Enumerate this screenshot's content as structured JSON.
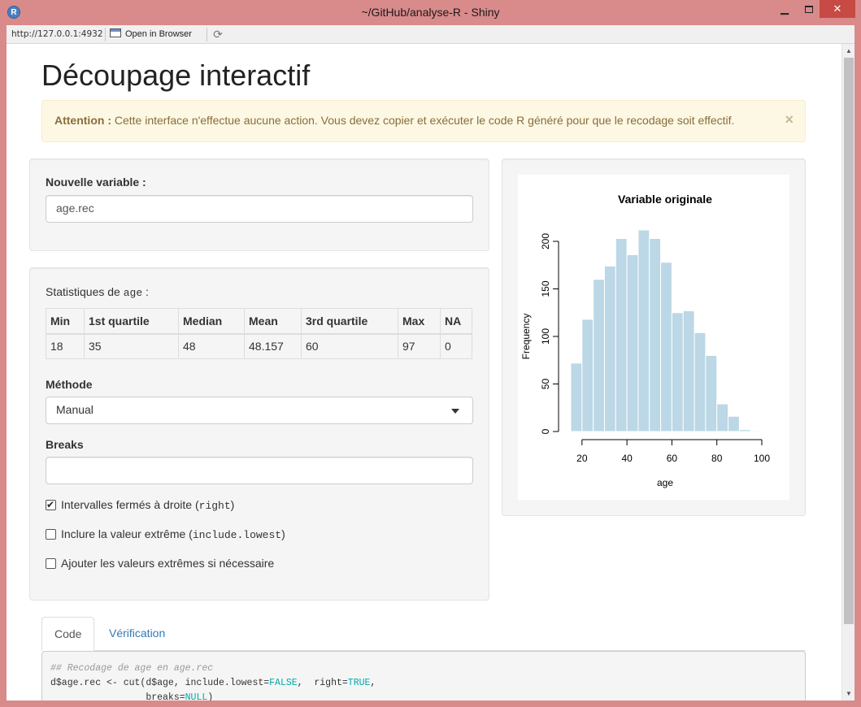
{
  "window": {
    "title": "~/GitHub/analyse-R - Shiny",
    "minimize": "—",
    "maximize": "",
    "close": "✕"
  },
  "toolbar": {
    "url": "http://127.0.0.1:4932",
    "open_in_browser": "Open in Browser"
  },
  "page": {
    "title": "Découpage interactif",
    "alert": {
      "strong": "Attention :",
      "text": "Cette interface n'effectue aucune action. Vous devez copier et exécuter le code R généré pour que le recodage soit effectif.",
      "close": "×"
    }
  },
  "new_variable": {
    "label": "Nouvelle variable :",
    "value": "age.rec"
  },
  "stats": {
    "caption_prefix": "Statistiques de",
    "variable": "age",
    "caption_suffix": ":",
    "headers": [
      "Min",
      "1st quartile",
      "Median",
      "Mean",
      "3rd quartile",
      "Max",
      "NA"
    ],
    "values": [
      "18",
      "35",
      "48",
      "48.157",
      "60",
      "97",
      "0"
    ]
  },
  "method": {
    "label": "Méthode",
    "selected": "Manual"
  },
  "breaks": {
    "label": "Breaks",
    "value": ""
  },
  "options": [
    {
      "text": "Intervalles fermés à droite",
      "code": "right",
      "checked": true
    },
    {
      "text": "Inclure la valeur extrême",
      "code": "include.lowest",
      "checked": false
    },
    {
      "text": "Ajouter les valeurs extrêmes si nécessaire",
      "code": "",
      "checked": false
    }
  ],
  "chart_data": {
    "type": "bar",
    "title": "Variable originale",
    "xlabel": "age",
    "ylabel": "Frequency",
    "bin_edges": [
      15,
      20,
      25,
      30,
      35,
      40,
      45,
      50,
      55,
      60,
      65,
      70,
      75,
      80,
      85,
      90,
      95,
      100
    ],
    "values": [
      72,
      118,
      160,
      174,
      203,
      186,
      212,
      203,
      178,
      125,
      127,
      104,
      80,
      29,
      16,
      2,
      1
    ],
    "xlim": [
      15,
      100
    ],
    "ylim": [
      0,
      200
    ],
    "xticks": [
      20,
      40,
      60,
      80,
      100
    ],
    "yticks": [
      0,
      50,
      100,
      150,
      200
    ],
    "bar_color": "#bcd7e6",
    "grid": false
  },
  "tabs": {
    "code": "Code",
    "verification": "Vérification"
  },
  "code": {
    "comment": "## Recodage de age en age.rec",
    "line1_a": "d$age.rec <- cut(d$age, include.lowest=",
    "line1_false": "FALSE",
    "line1_b": ",  right=",
    "line1_true": "TRUE",
    "line1_c": ",",
    "line2_a": "                 breaks=",
    "line2_null": "NULL",
    "line2_b": ")"
  }
}
